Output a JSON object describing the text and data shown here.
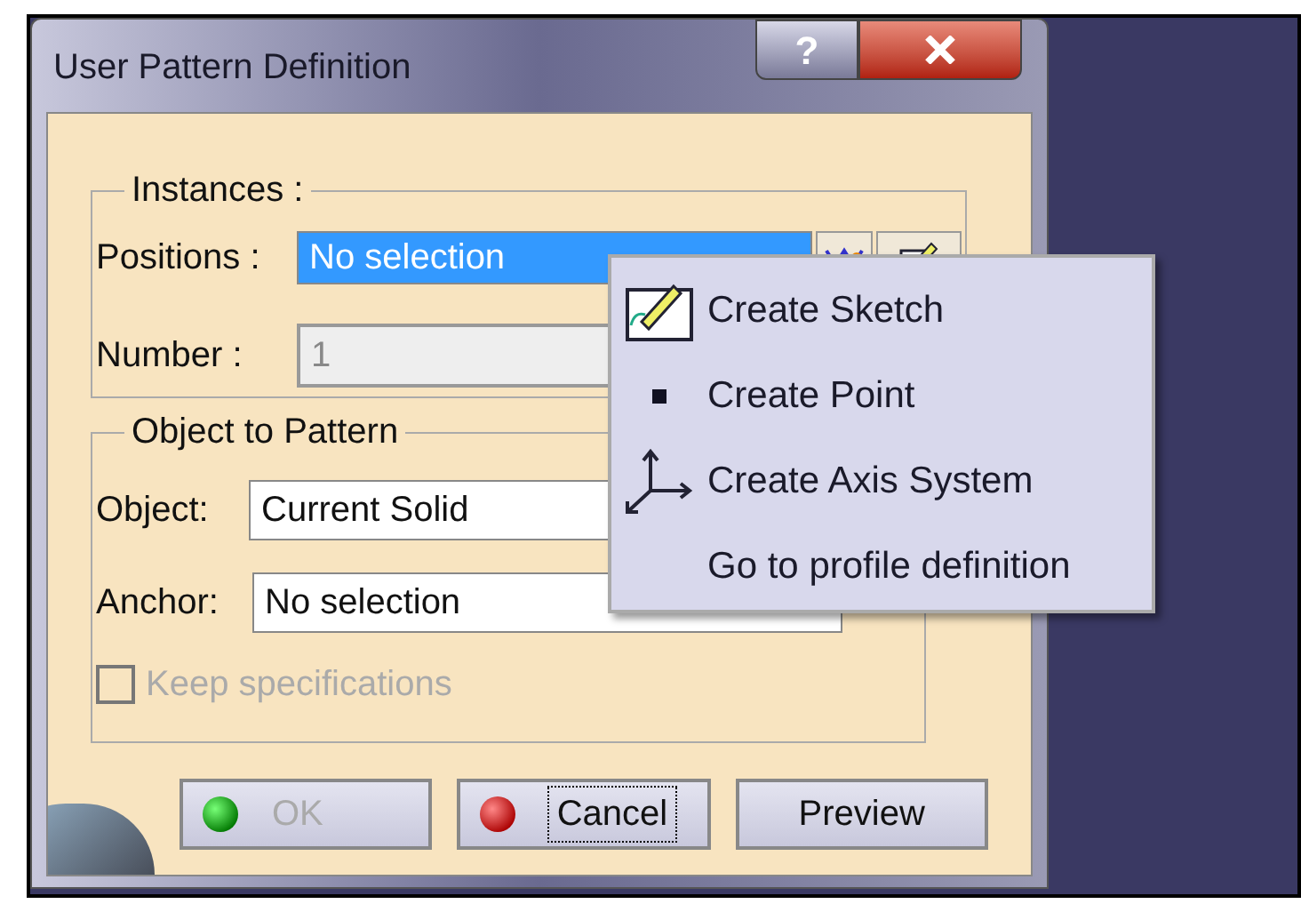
{
  "window": {
    "title": "User Pattern Definition",
    "help": "?"
  },
  "instances": {
    "label": "Instances :",
    "positions": {
      "label": "Positions :",
      "value": "No selection",
      "selected": true
    },
    "number": {
      "label": "Number :",
      "value": "1",
      "disabled": true
    }
  },
  "object_to_pattern": {
    "label": "Object to Pattern",
    "object": {
      "label": "Object:",
      "value": "Current Solid"
    },
    "anchor": {
      "label": "Anchor:",
      "value": "No selection"
    },
    "keep_specifications": {
      "label": "Keep specifications",
      "checked": false,
      "disabled": true
    }
  },
  "buttons": [
    {
      "label": "OK",
      "kind": "ok",
      "disabled": true,
      "focused": false
    },
    {
      "label": "Cancel",
      "kind": "cancel",
      "disabled": false,
      "focused": true
    },
    {
      "label": "Preview",
      "kind": "plain",
      "disabled": false,
      "focused": false
    }
  ],
  "context_menu": {
    "items": [
      {
        "label": "Create Sketch",
        "kind": "sketch"
      },
      {
        "label": "Create Point",
        "kind": "point"
      },
      {
        "label": "Create Axis System",
        "kind": "axis"
      },
      {
        "label": "Go to profile definition",
        "kind": "plain"
      }
    ]
  }
}
